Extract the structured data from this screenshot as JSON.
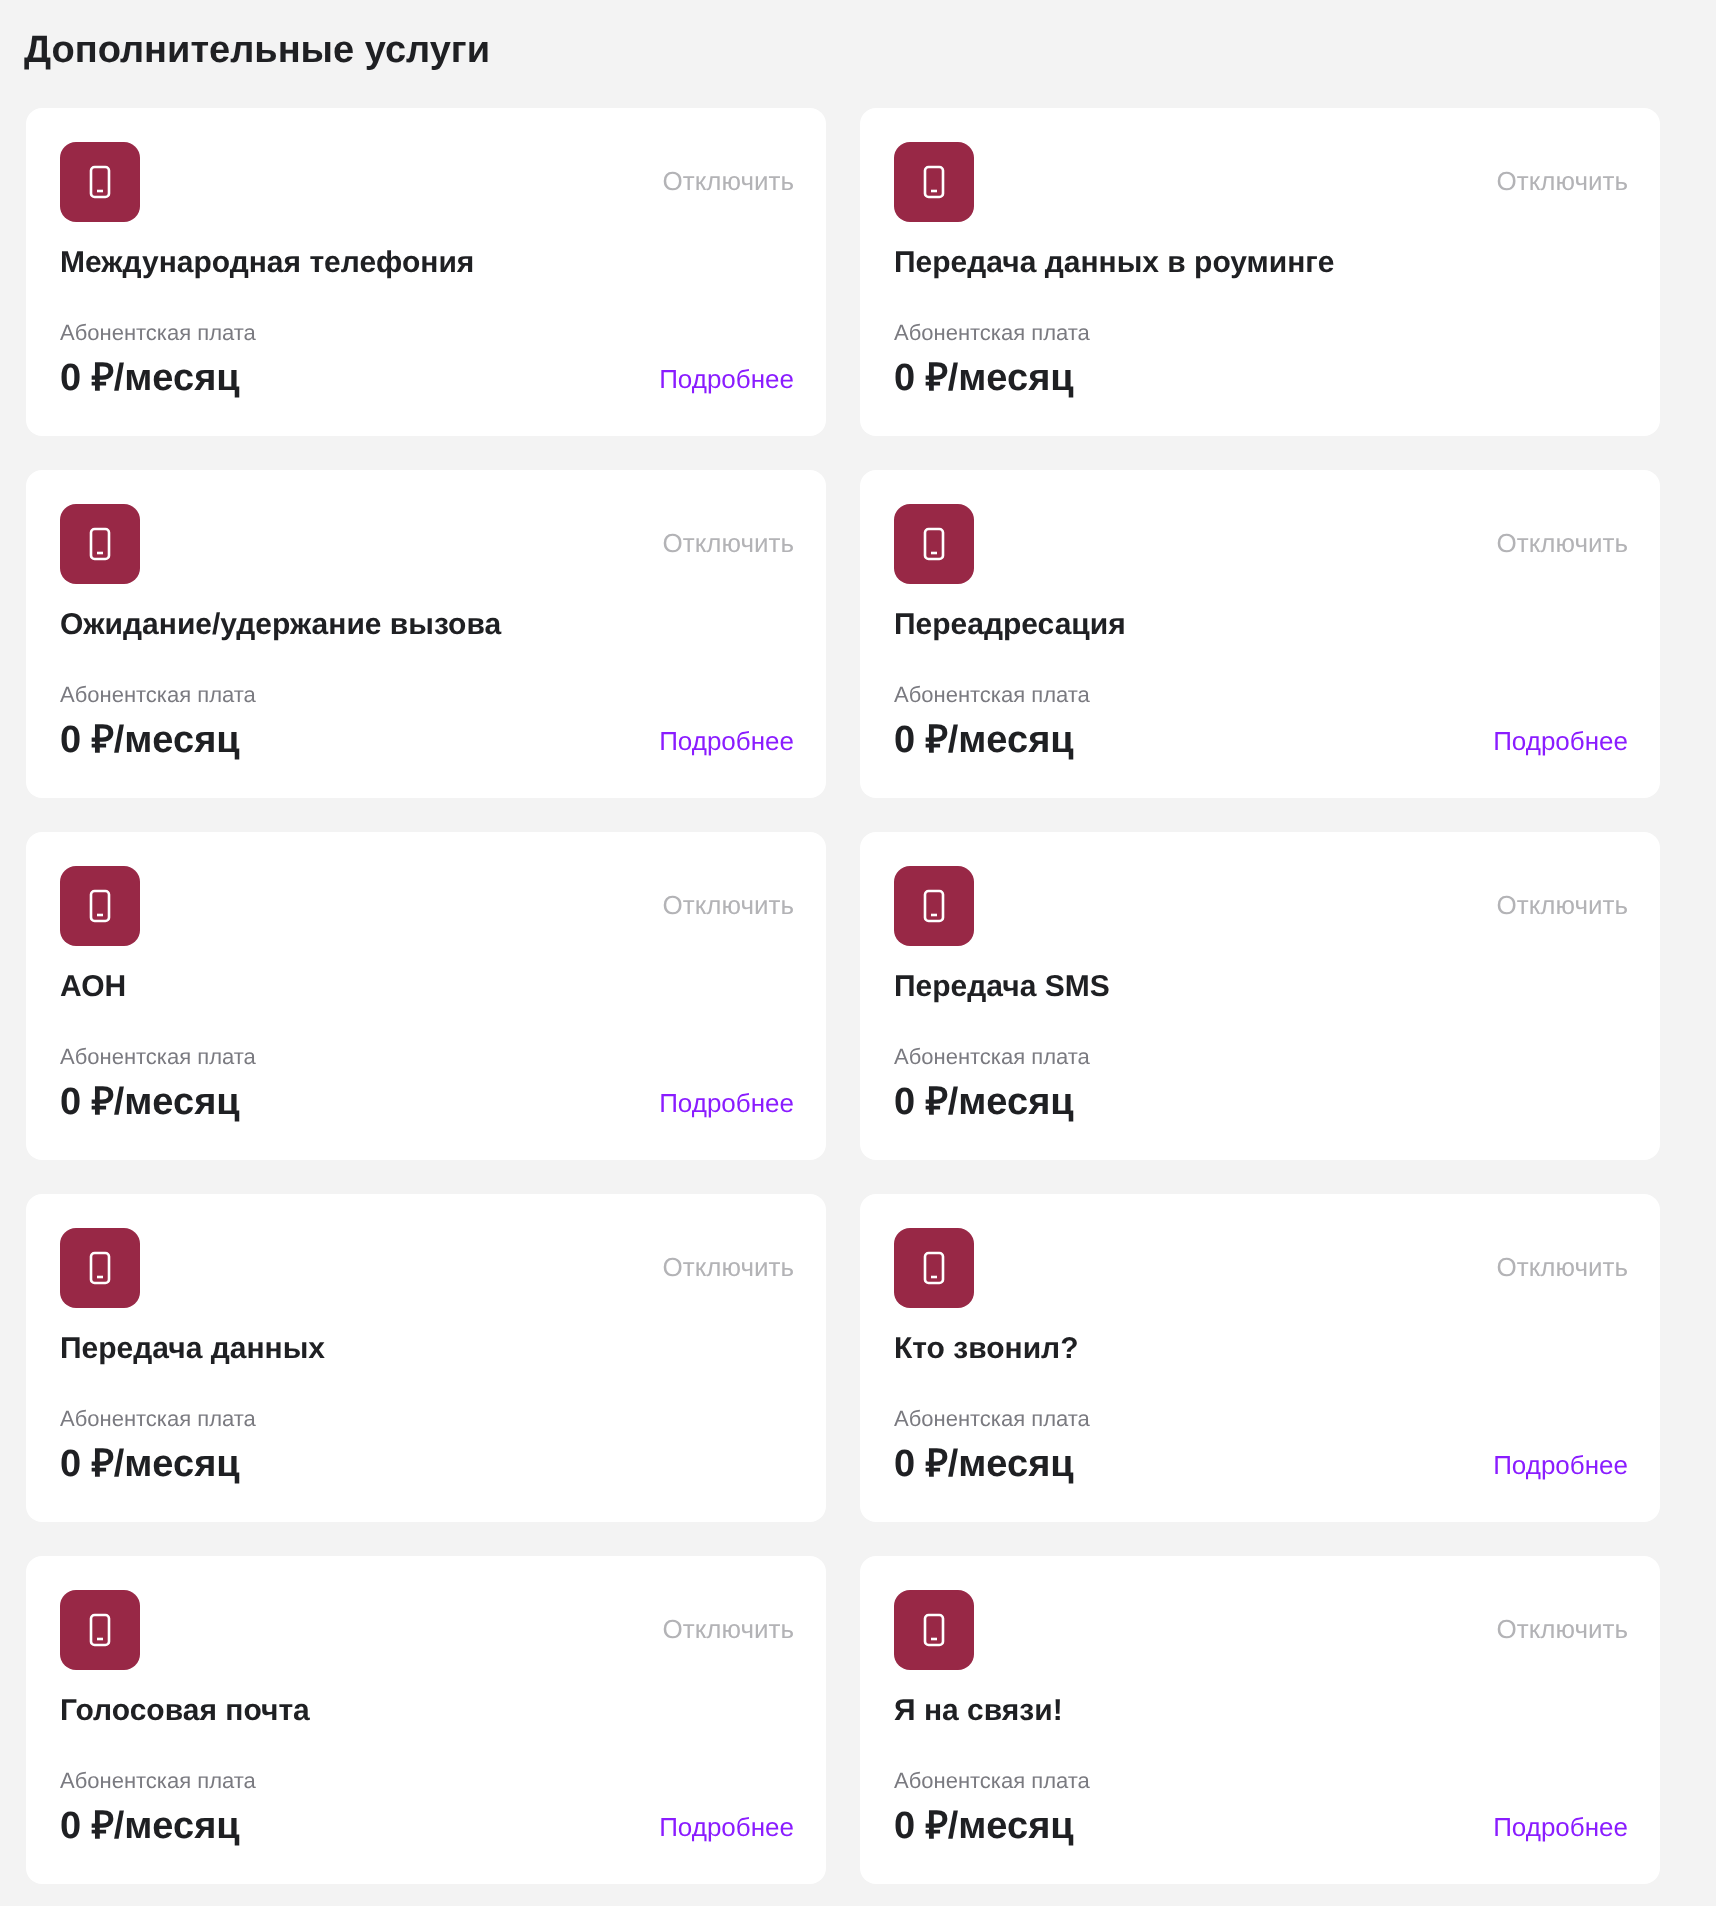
{
  "title": "Дополнительные услуги",
  "services": [
    {
      "name": "Международная телефония",
      "action": "Отключить",
      "fee_label": "Абонентская плата",
      "price": "0 ₽/месяц",
      "details": "Подробнее"
    },
    {
      "name": "Передача данных в роуминге",
      "action": "Отключить",
      "fee_label": "Абонентская плата",
      "price": "0 ₽/месяц"
    },
    {
      "name": "Ожидание/удержание вызова",
      "action": "Отключить",
      "fee_label": "Абонентская плата",
      "price": "0 ₽/месяц",
      "details": "Подробнее"
    },
    {
      "name": "Переадресация",
      "action": "Отключить",
      "fee_label": "Абонентская плата",
      "price": "0 ₽/месяц",
      "details": "Подробнее"
    },
    {
      "name": "АОН",
      "action": "Отключить",
      "fee_label": "Абонентская плата",
      "price": "0 ₽/месяц",
      "details": "Подробнее"
    },
    {
      "name": "Передача SMS",
      "action": "Отключить",
      "fee_label": "Абонентская плата",
      "price": "0 ₽/месяц"
    },
    {
      "name": "Передача данных",
      "action": "Отключить",
      "fee_label": "Абонентская плата",
      "price": "0 ₽/месяц"
    },
    {
      "name": "Кто звонил?",
      "action": "Отключить",
      "fee_label": "Абонентская плата",
      "price": "0 ₽/месяц",
      "details": "Подробнее"
    },
    {
      "name": "Голосовая почта",
      "action": "Отключить",
      "fee_label": "Абонентская плата",
      "price": "0 ₽/месяц",
      "details": "Подробнее"
    },
    {
      "name": "Я на связи!",
      "action": "Отключить",
      "fee_label": "Абонентская плата",
      "price": "0 ₽/месяц",
      "details": "Подробнее"
    }
  ]
}
